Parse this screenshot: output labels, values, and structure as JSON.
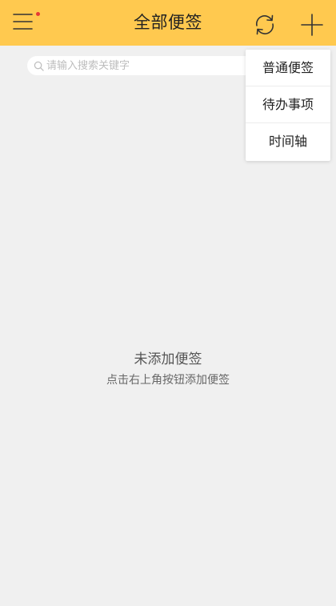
{
  "header": {
    "title": "全部便签",
    "menu_icon": "menu-icon",
    "notification_dot_color": "#e53935",
    "sync_icon": "sync-icon",
    "add_icon": "add-icon",
    "background_color": "#ffc94f"
  },
  "search": {
    "placeholder": "请输入搜索关键字",
    "value": "",
    "icon": "search-icon"
  },
  "add_menu": {
    "items": [
      {
        "label": "普通便签"
      },
      {
        "label": "待办事项"
      },
      {
        "label": "时间轴"
      }
    ]
  },
  "empty_state": {
    "title": "未添加便签",
    "hint": "点击右上角按钮添加便签"
  }
}
